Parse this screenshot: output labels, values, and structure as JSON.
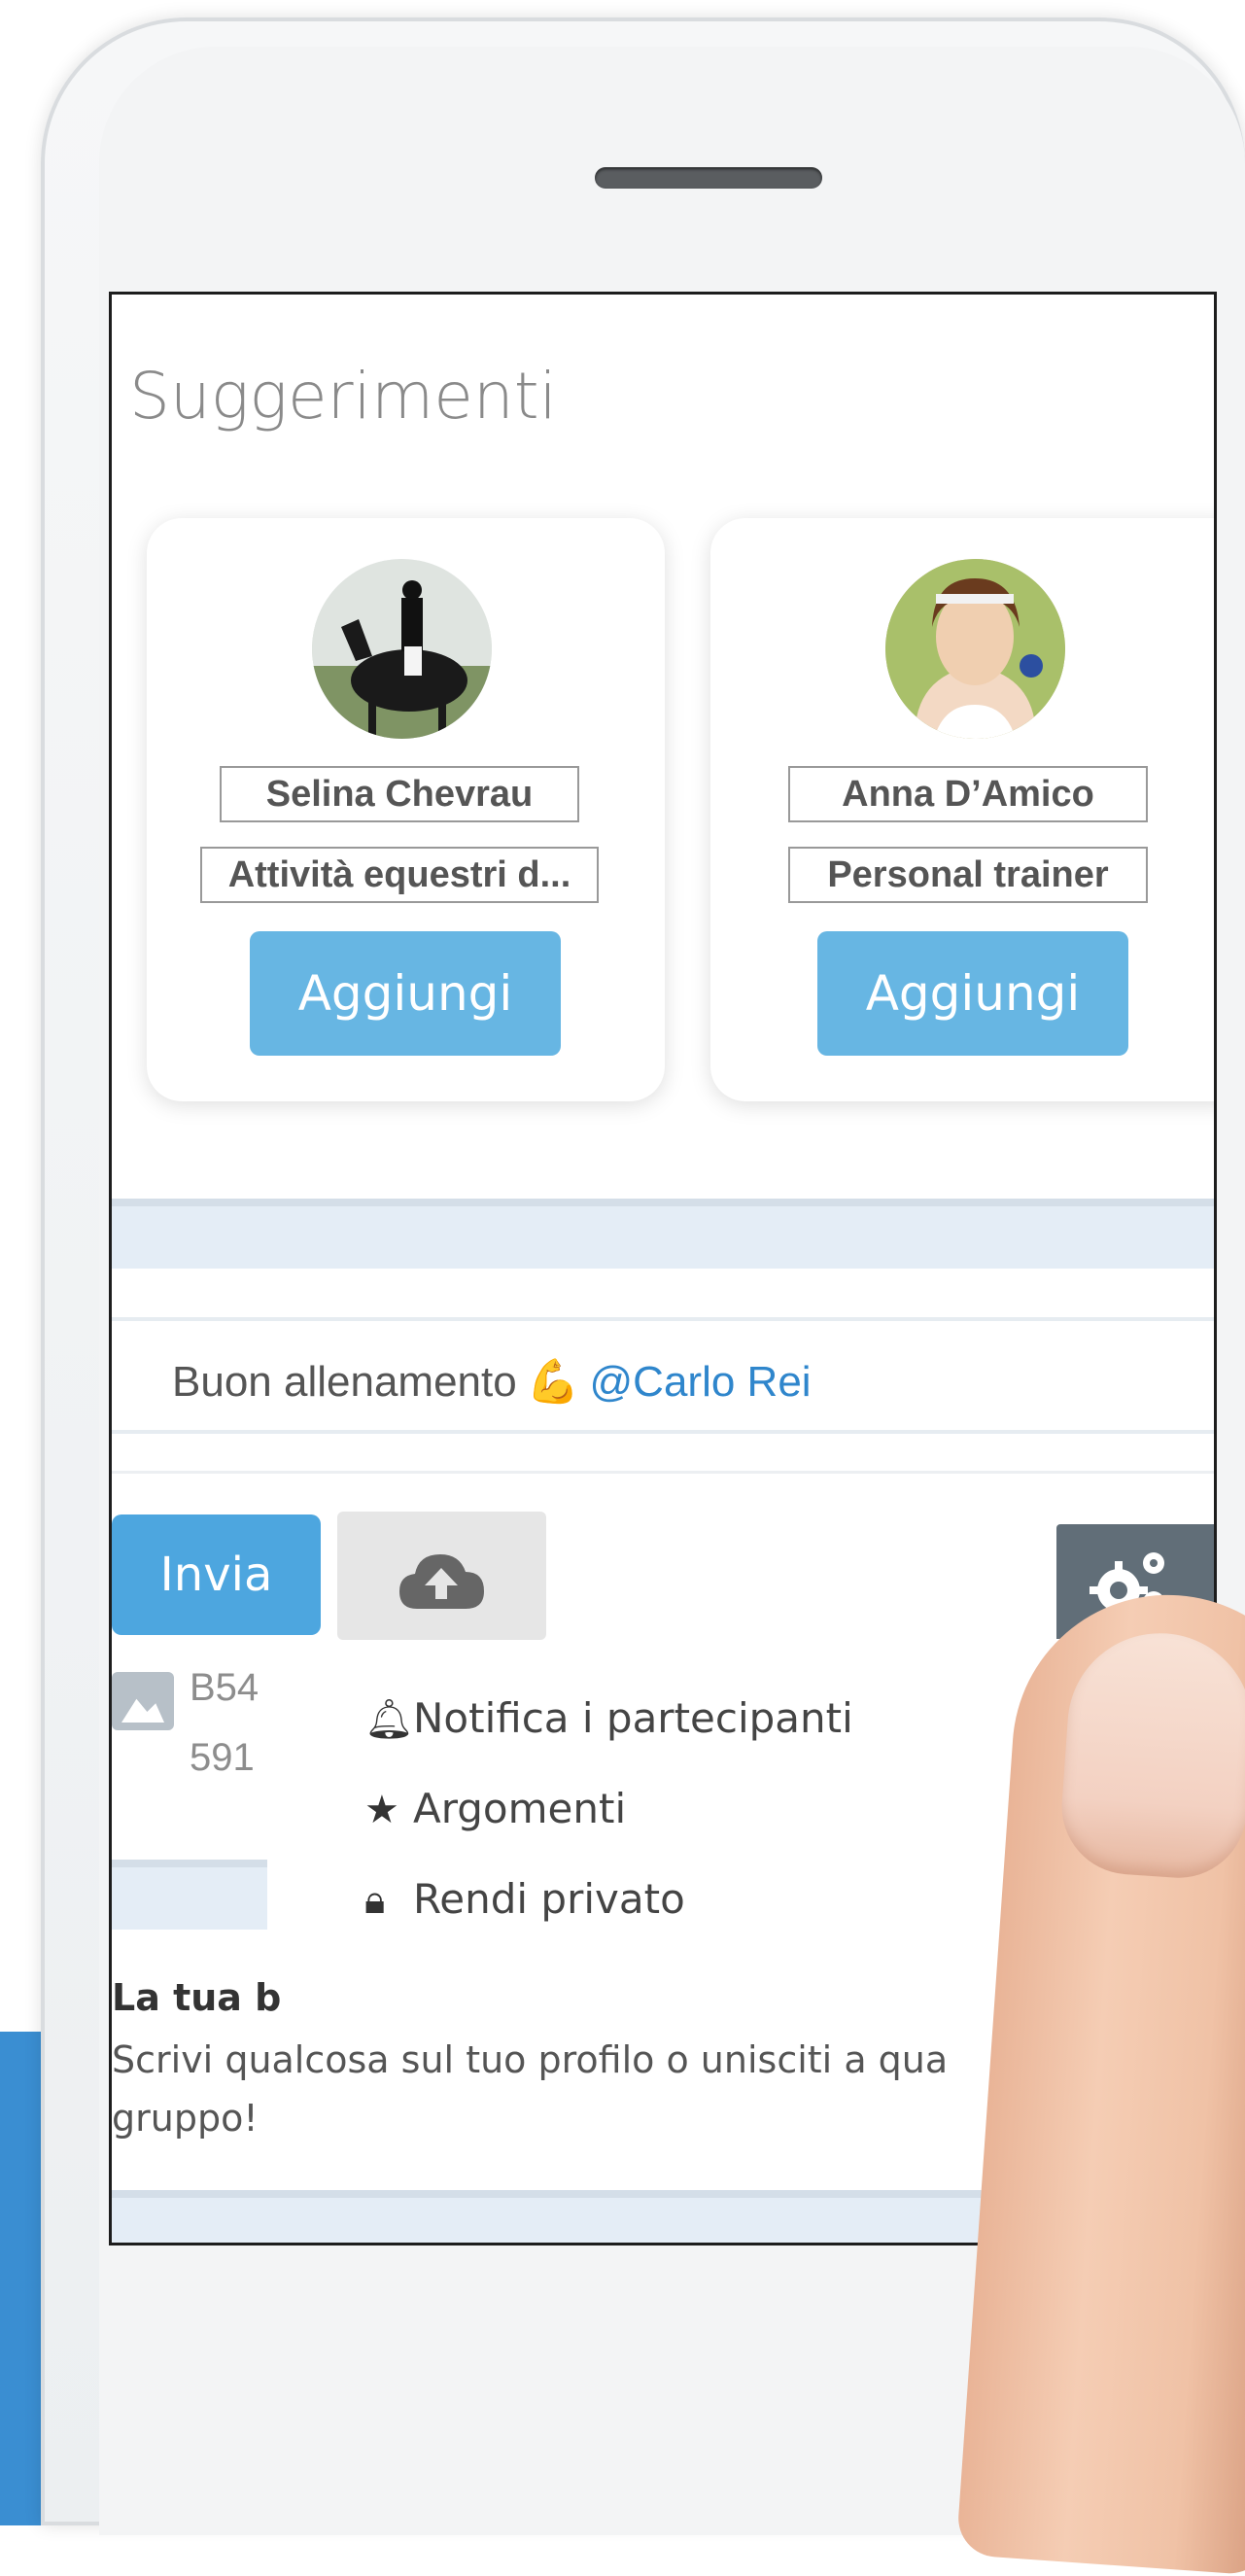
{
  "colors": {
    "accent_blue": "#67b6e3",
    "send_blue": "#4da6df",
    "mention_blue": "#2f86cc",
    "settings_gray": "#616e78",
    "background_accent": "#3a8ed2"
  },
  "section_title": "Suggerimenti",
  "suggestions": [
    {
      "name": "Selina Chevrau",
      "role": "Attività equestri d...",
      "button": "Aggiungi",
      "avatar": "rider-on-horse-photo"
    },
    {
      "name": "Anna D’Amico",
      "role": "Personal trainer",
      "button": "Aggiungi",
      "avatar": "smiling-woman-photo"
    }
  ],
  "composer": {
    "text": "Buon allenamento",
    "emoji": "💪",
    "mention": "@Carlo Rei"
  },
  "toolbar": {
    "send_label": "Invia",
    "upload_icon": "cloud-upload-icon",
    "settings_icon": "gears-icon"
  },
  "attachment": {
    "name": "B54",
    "size": "591"
  },
  "dropdown": {
    "items": [
      {
        "label": "Notifica i partecipanti",
        "icon": "bell-icon"
      },
      {
        "label": "Argomenti",
        "icon": "star-icon"
      },
      {
        "label": "Rendi privato",
        "icon": "lock-icon"
      }
    ]
  },
  "empty_state": {
    "title": "La tua b",
    "description": "Scrivi qualcosa sul tuo profilo o unisciti a qua gruppo!"
  }
}
